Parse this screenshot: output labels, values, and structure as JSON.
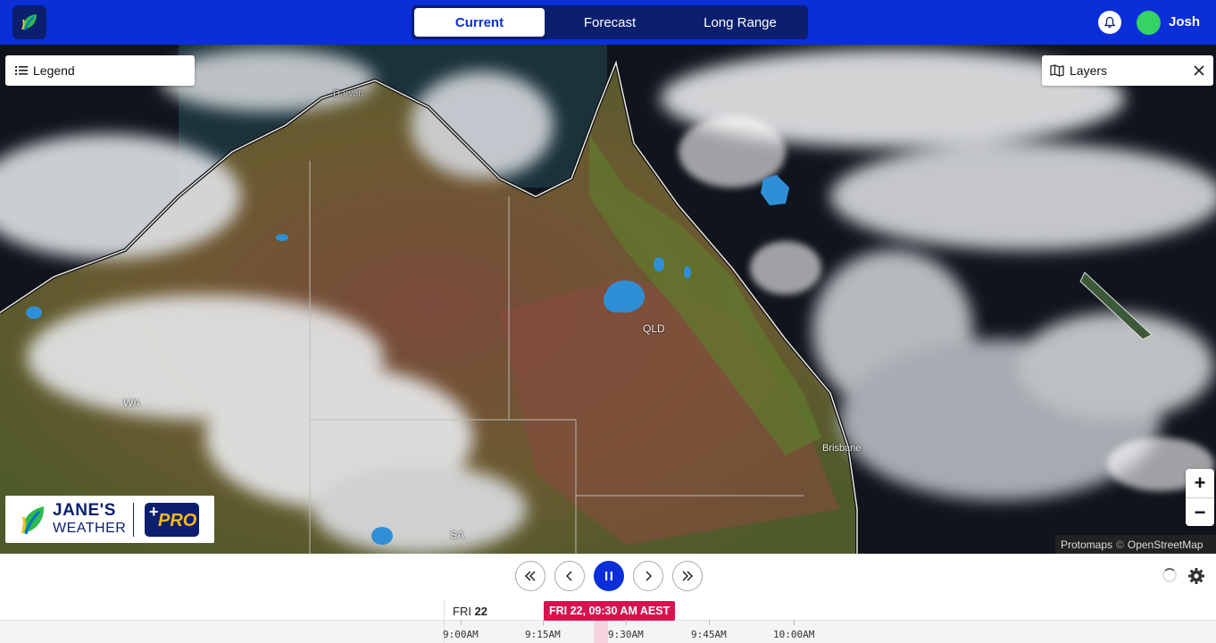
{
  "header": {
    "tabs": [
      {
        "label": "Current",
        "active": true
      },
      {
        "label": "Forecast",
        "active": false
      },
      {
        "label": "Long Range",
        "active": false
      }
    ],
    "username": "Josh"
  },
  "map": {
    "legend_label": "Legend",
    "layers_label": "Layers",
    "place_labels": {
      "darwin": "Darwin",
      "qld": "QLD",
      "wa": "WA",
      "brisbane": "Brisbane",
      "sa": "SA"
    },
    "zoom_in": "+",
    "zoom_out": "−",
    "attribution": {
      "protomaps": "Protomaps",
      "separator": "©",
      "osm": "OpenStreetMap"
    },
    "brand": {
      "line1": "JANE'S",
      "line2": "WEATHER",
      "badge": "PRO",
      "plus": "+"
    }
  },
  "playback": {
    "buttons": [
      "skip-back",
      "step-back",
      "pause",
      "step-forward",
      "skip-forward"
    ]
  },
  "timeline": {
    "day_name": "FRI",
    "day_number": "22",
    "current_time": "FRI 22, 09:30 AM AEST",
    "ticks": [
      "9:00AM",
      "9:15AM",
      "9:30AM",
      "9:45AM",
      "10:00AM"
    ]
  },
  "colors": {
    "primary": "#0a2fd8",
    "navy": "#0b1f6e",
    "now_marker": "#d6134e",
    "avatar": "#34d363",
    "rain": "#2f8fd6"
  }
}
